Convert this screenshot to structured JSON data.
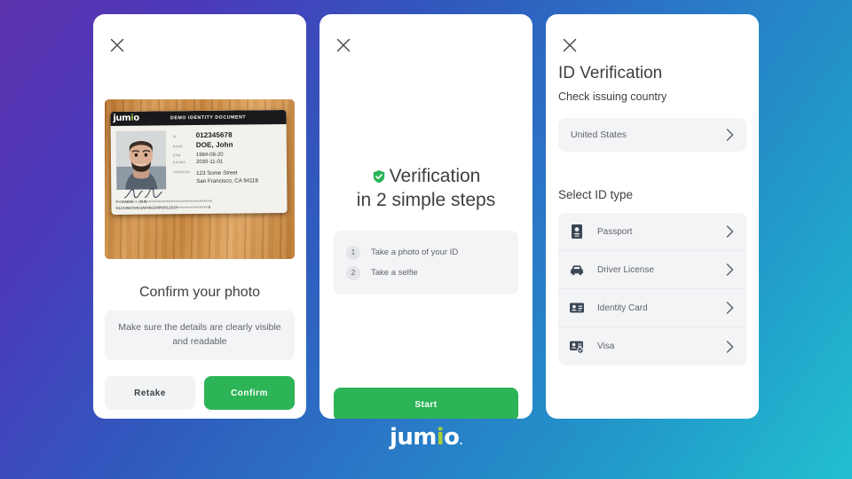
{
  "brand": {
    "name_part1": "jum",
    "name_i": "i",
    "name_part2": "o",
    "trademark": ".",
    "green": "#a6ce39",
    "primary_green": "#2cb457"
  },
  "background": {
    "gradient_from": "#5c31ad",
    "gradient_mid": "#2a77c6",
    "gradient_to": "#22bfd0"
  },
  "panel_confirm": {
    "close_icon": "close-icon",
    "title": "Confirm your photo",
    "hint": "Make sure the details are clearly visible and readable",
    "retake_label": "Retake",
    "confirm_label": "Confirm",
    "id_card": {
      "logo_part1": "jum",
      "logo_i": "i",
      "logo_part2": "o",
      "banner": "DEMO IDENTITY DOCUMENT",
      "fields": [
        {
          "key": "ID",
          "value": "012345678",
          "emphasis": true
        },
        {
          "key": "NAME",
          "value": "DOE, John",
          "emphasis": true
        },
        {
          "key": "DOB",
          "value": "1984-08-20",
          "emphasis": false
        },
        {
          "key": "EXPIRY",
          "value": "2030-11-01",
          "emphasis": false
        }
      ],
      "address_key": "ADDRESS",
      "address_line1": "123 Some Street",
      "address_line2": "San Francisco, CA 94118",
      "mrz_line1": "P<USADOE<<JOHN<<<<<<<<<<<<<<<<<<<<<<<<<<<<<<",
      "mrz_line2": "0123456784U1A8408200M3011010<<<<<<<<<<<<<<6"
    }
  },
  "panel_intro": {
    "close_icon": "close-icon",
    "shield_icon": "shield-check-icon",
    "heading_line1": "Verification",
    "heading_line2": "in 2 simple steps",
    "steps": [
      {
        "number": "1",
        "label": "Take a photo of your ID"
      },
      {
        "number": "2",
        "label": "Take a selfie"
      }
    ],
    "start_label": "Start"
  },
  "panel_idtype": {
    "close_icon": "close-icon",
    "title": "ID Verification",
    "subtitle": "Check issuing country",
    "country_value": "United States",
    "section_label": "Select ID type",
    "id_types": [
      {
        "icon": "passport-icon",
        "label": "Passport"
      },
      {
        "icon": "car-icon",
        "label": "Driver License"
      },
      {
        "icon": "identity-card-icon",
        "label": "Identity Card"
      },
      {
        "icon": "visa-card-icon",
        "label": "Visa"
      }
    ]
  }
}
